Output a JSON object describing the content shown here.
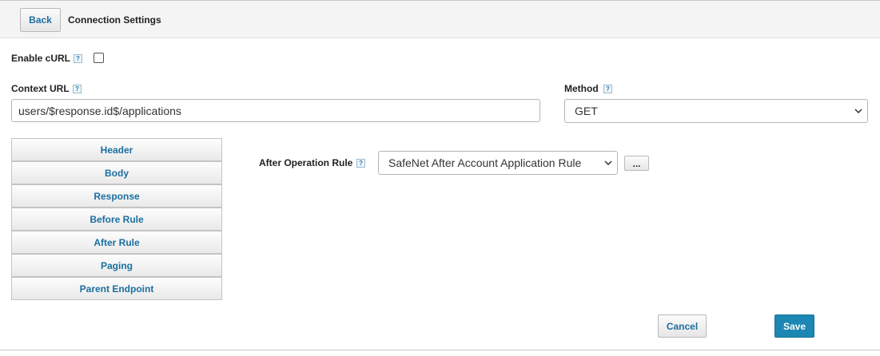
{
  "header": {
    "back_label": "Back",
    "title": "Connection Settings"
  },
  "enable_curl": {
    "label": "Enable cURL",
    "help": "?",
    "checked": false
  },
  "context_url": {
    "label": "Context URL",
    "help": "?",
    "value": "users/$response.id$/applications"
  },
  "method": {
    "label": "Method",
    "help": "?",
    "selected": "GET"
  },
  "tabs": [
    {
      "label": "Header"
    },
    {
      "label": "Body"
    },
    {
      "label": "Response"
    },
    {
      "label": "Before Rule"
    },
    {
      "label": "After Rule"
    },
    {
      "label": "Paging"
    },
    {
      "label": "Parent Endpoint"
    }
  ],
  "after_operation_rule": {
    "label": "After Operation Rule",
    "help": "?",
    "selected": "SafeNet After Account Application Rule",
    "more_label": "..."
  },
  "footer": {
    "cancel_label": "Cancel",
    "save_label": "Save"
  },
  "icons": {
    "select_arrow": "chevron-down-icon",
    "help": "help-icon"
  },
  "colors": {
    "link_blue": "#1a6fa0",
    "save_bg": "#1b87b2"
  }
}
